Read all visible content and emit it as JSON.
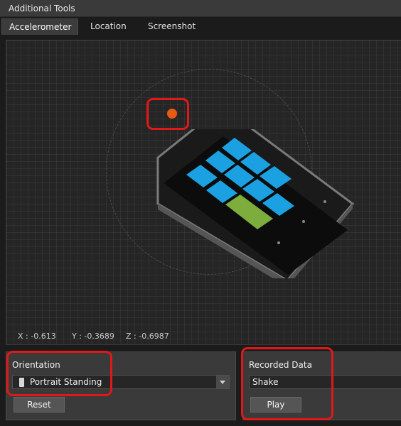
{
  "window": {
    "title": "Additional Tools"
  },
  "tabs": [
    {
      "label": "Accelerometer",
      "active": true
    },
    {
      "label": "Location",
      "active": false
    },
    {
      "label": "Screenshot",
      "active": false
    }
  ],
  "accelerometer": {
    "coords": {
      "x": "X : -0.613",
      "y": "Y : -0.3689",
      "z": "Z : -0.6987"
    }
  },
  "orientation": {
    "label": "Orientation",
    "selected": "Portrait Standing",
    "reset_label": "Reset"
  },
  "recorded": {
    "label": "Recorded Data",
    "value": "Shake",
    "play_label": "Play"
  },
  "colors": {
    "accent_dot": "#e85a12",
    "highlight": "#e01818",
    "tile_blue": "#1ba1e2",
    "tile_green": "#7dad3c"
  }
}
